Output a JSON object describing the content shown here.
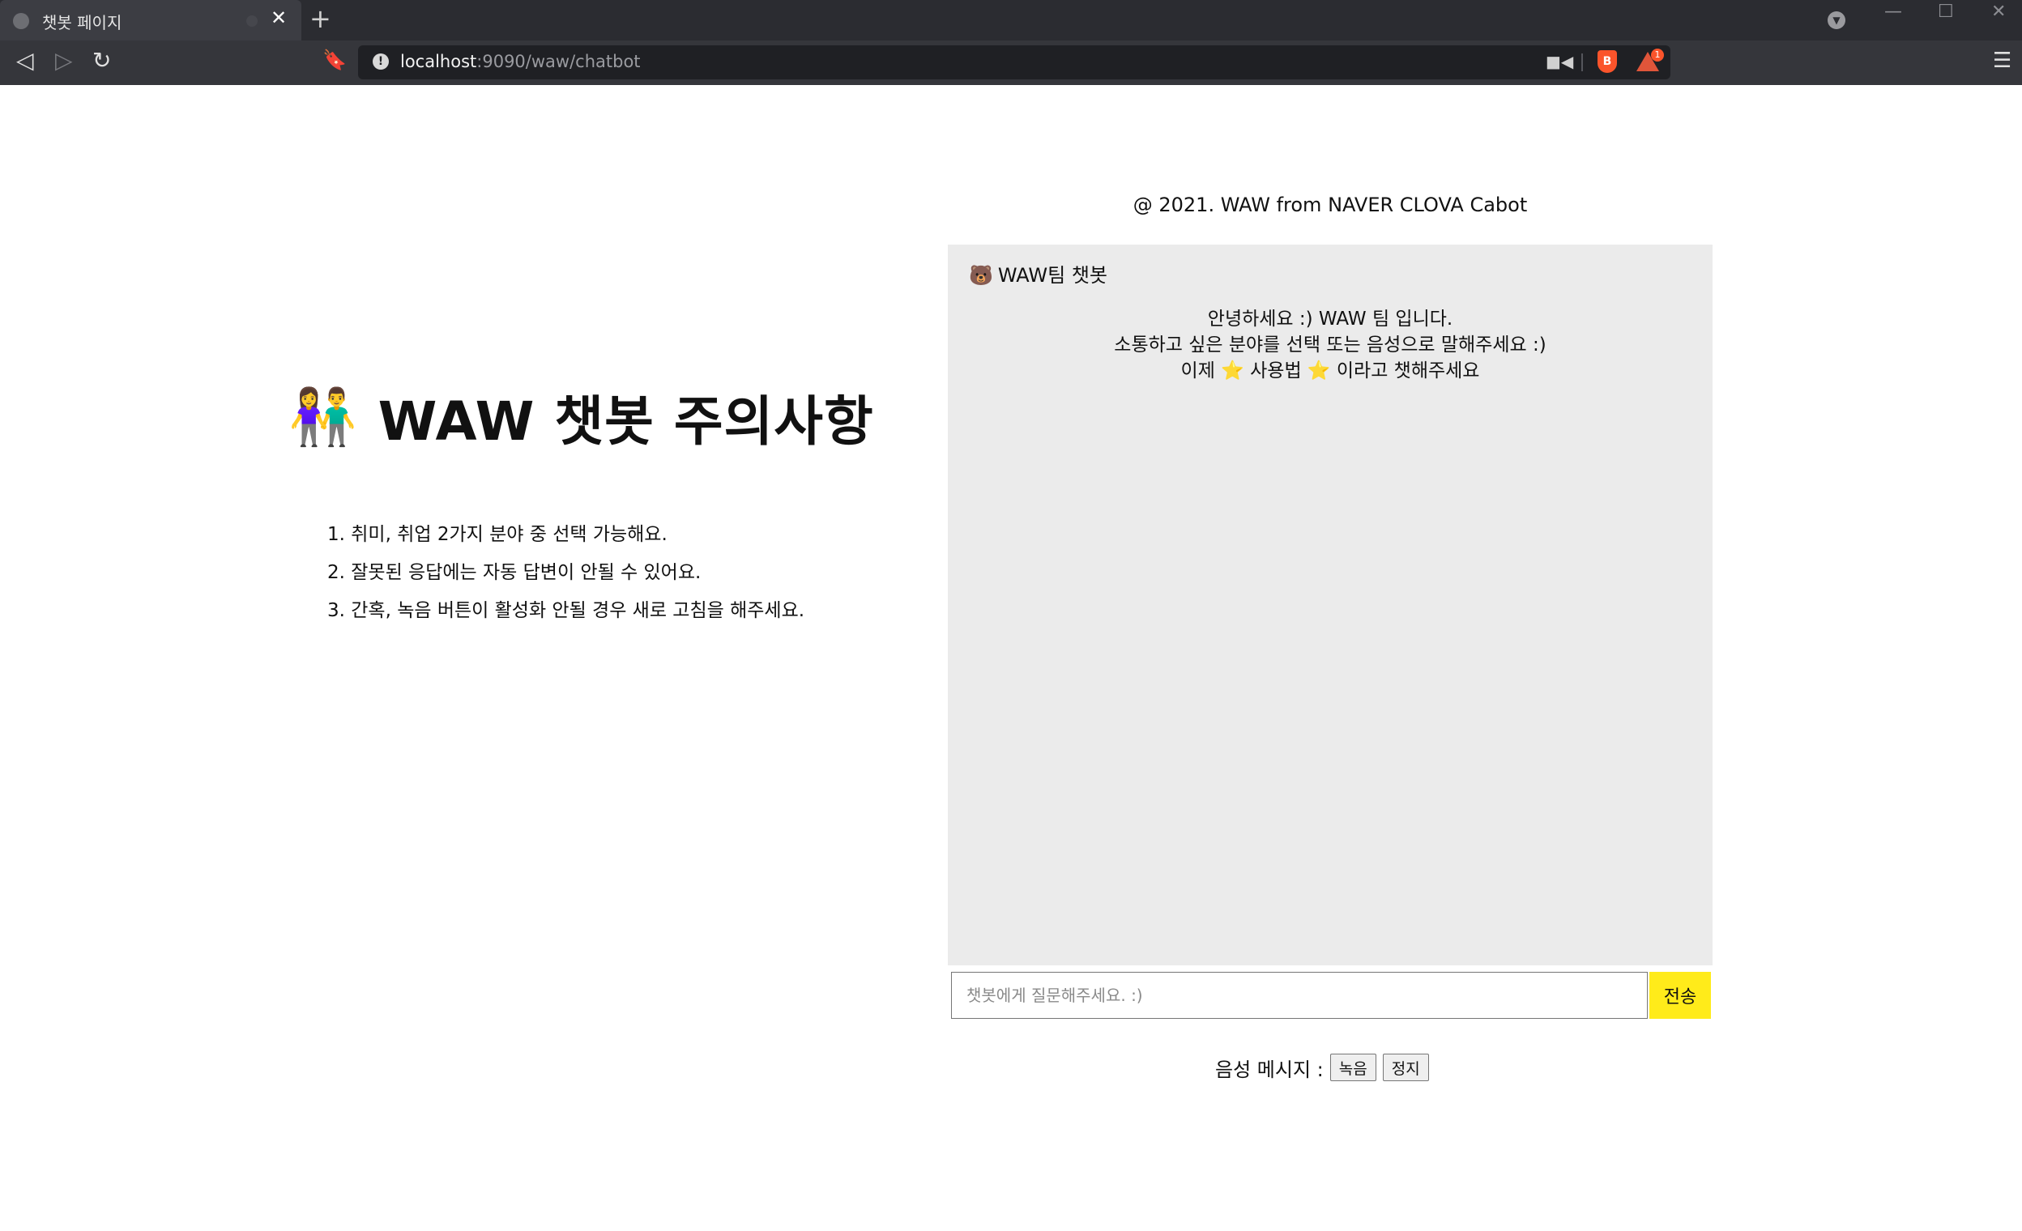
{
  "browser": {
    "tab_title": "챗봇 페이지",
    "tab_close": "✕",
    "new_tab": "+",
    "url_host": "localhost",
    "url_rest": ":9090/waw/chatbot",
    "rewards_badge": "1",
    "icons": {
      "back": "back-icon",
      "forward": "forward-icon",
      "reload": "reload-icon",
      "bookmark": "bookmark-icon",
      "camera": "camera-icon",
      "shield": "brave-shield-icon",
      "rewards": "brave-rewards-icon",
      "menu": "hamburger-menu-icon"
    }
  },
  "notice": {
    "emoji": "👫",
    "title": "WAW 챗봇 주의사항",
    "items": [
      "1. 취미, 취업 2가지 분야 중 선택 가능해요.",
      "2. 잘못된 응답에는 자동 답변이 안될 수 있어요.",
      "3. 간혹, 녹음 버튼이 활성화 안될 경우 새로 고침을 해주세요."
    ]
  },
  "chat": {
    "copyright": "@ 2021. WAW from NAVER CLOVA Cabot",
    "header_icon": "🐻",
    "header_title": "WAW팀 챗봇",
    "greeting": {
      "line1": "안녕하세요 :) WAW 팀 입니다.",
      "line2": "소통하고 싶은 분야를 선택 또는 음성으로 말해주세요 :)",
      "line3_prefix": "이제",
      "star": "⭐",
      "line3_middle": "사용법",
      "line3_suffix": "이라고 챗해주세요"
    },
    "input_placeholder": "챗봇에게 질문해주세요. :)",
    "input_value": "",
    "send_label": "전송"
  },
  "voice": {
    "label": "음성 메시지 :",
    "record_label": "녹음",
    "stop_label": "정지"
  },
  "colors": {
    "chrome_bg": "#35363b",
    "chat_bg": "#ebebeb",
    "send_button": "#ffeb1a"
  }
}
